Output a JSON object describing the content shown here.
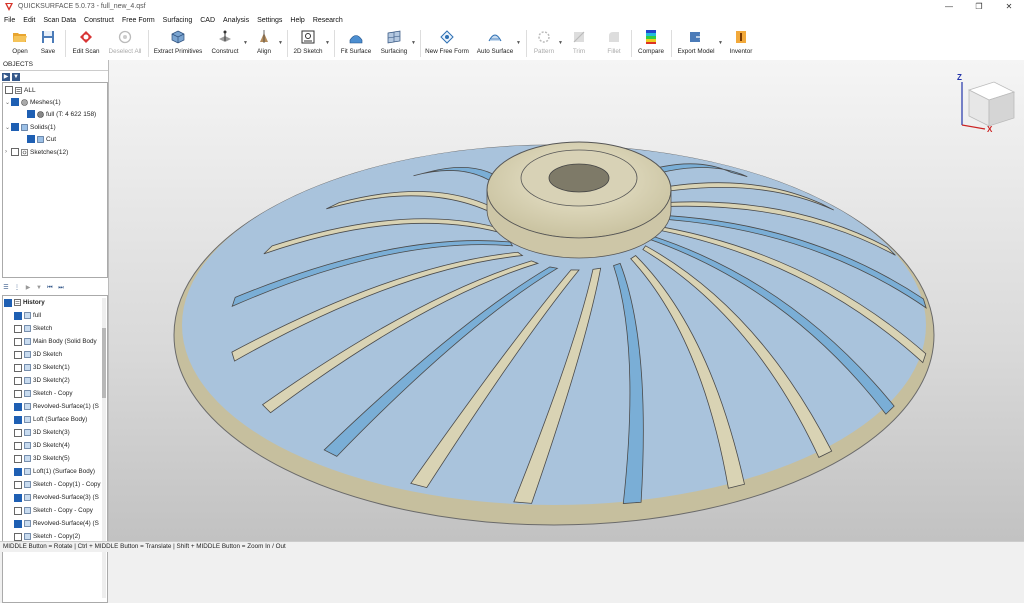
{
  "window": {
    "title": "QUICKSURFACE 5.0.73 - full_new_4.qsf",
    "controls": [
      "—",
      "❐",
      "✕"
    ]
  },
  "menu": [
    "File",
    "Edit",
    "Scan Data",
    "Construct",
    "Free Form",
    "Surfacing",
    "CAD",
    "Analysis",
    "Settings",
    "Help",
    "Research"
  ],
  "toolbar": {
    "open": "Open",
    "save": "Save",
    "edit_scan": "Edit Scan",
    "deselect_all": "Deselect All",
    "extract_primitives": "Extract Primitives",
    "construct": "Construct",
    "align": "Align",
    "sketch_2d": "2D Sketch",
    "fit_surface": "Fit Surface",
    "surfacing": "Surfacing",
    "new_free_form": "New Free Form",
    "auto_surface": "Auto Surface",
    "pattern": "Pattern",
    "trim": "Trim",
    "fillet": "Fillet",
    "compare": "Compare",
    "export_model": "Export Model",
    "inventor": "Inventor"
  },
  "objects_panel": {
    "header": "OBJECTS",
    "all": "ALL",
    "meshes": "Meshes(1)",
    "mesh_item": "full (T: 4 622 158)",
    "solids": "Solids(1)",
    "solid_item": "Cut",
    "sketches": "Sketches(12)"
  },
  "history": {
    "header": "History",
    "items": [
      "full",
      "Sketch",
      "Main Body (Solid Body",
      "3D Sketch",
      "3D Sketch(1)",
      "3D Sketch(2)",
      "Sketch - Copy",
      "Revolved-Surface(1) (S",
      "Loft (Surface Body)",
      "3D Sketch(3)",
      "3D Sketch(4)",
      "3D Sketch(5)",
      "Loft(1) (Surface Body)",
      "Sketch - Copy(1) - Copy",
      "Revolved-Surface(3) (S",
      "Sketch - Copy - Copy",
      "Revolved-Surface(4) (S",
      "Sketch - Copy(2)"
    ],
    "checked": [
      true,
      false,
      false,
      false,
      false,
      false,
      false,
      true,
      true,
      false,
      false,
      false,
      true,
      false,
      true,
      false,
      true,
      false
    ]
  },
  "view_cube": {
    "z_label": "Z",
    "x_label": "X"
  },
  "status": "MIDDLE Button = Rotate | Ctrl + MIDDLE Button = Translate | Shift + MIDDLE Button = Zoom In / Out",
  "colors": {
    "mesh_blue": "#7aaed6",
    "surface_beige": "#d9d3b4",
    "accent_blue": "#1e5fb3"
  }
}
